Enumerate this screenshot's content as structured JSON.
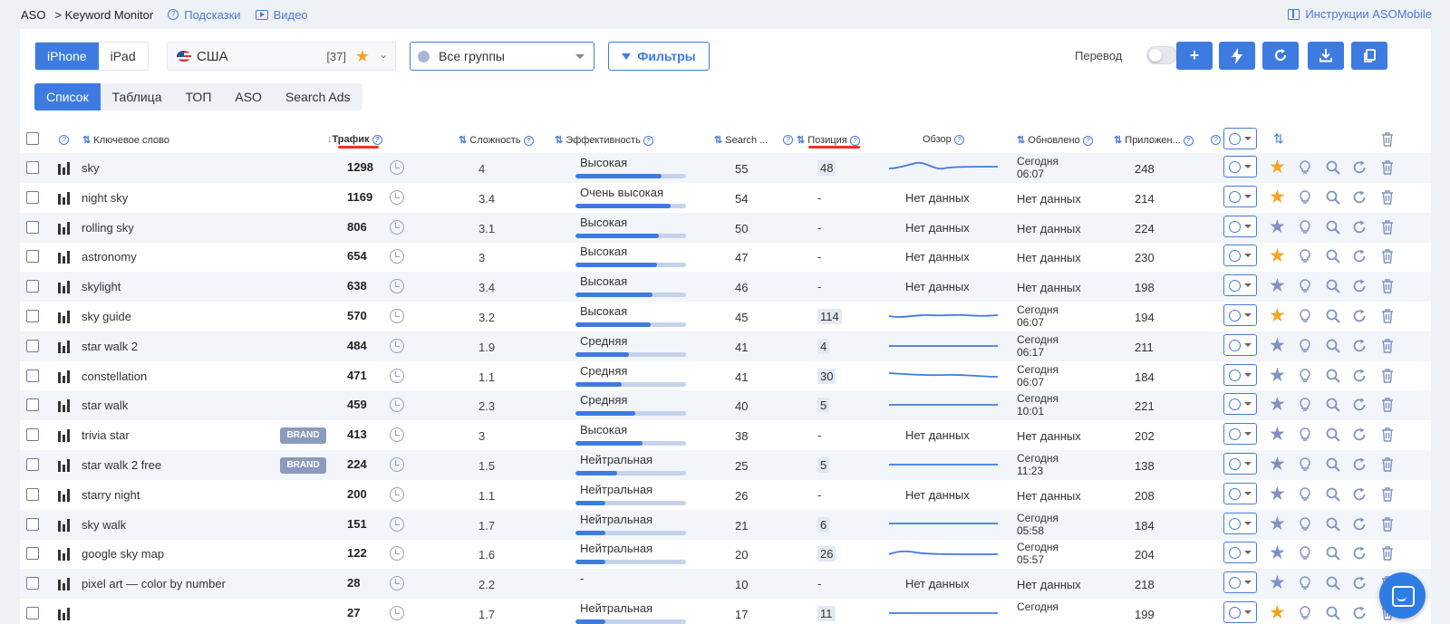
{
  "topbar": {
    "app": "ASO",
    "section": "> Keyword Monitor",
    "hints": "Подсказки",
    "video": "Видео",
    "instructions": "Инструкции ASOMobile"
  },
  "device_tabs": [
    "iPhone",
    "iPad"
  ],
  "device_selected": "iPhone",
  "country": {
    "name": "США",
    "count": "[37]"
  },
  "group_select": "Все группы",
  "filters_label": "Фильтры",
  "translate_label": "Перевод",
  "view_tabs": [
    "Список",
    "Таблица",
    "ТОП",
    "ASO",
    "Search Ads"
  ],
  "view_selected": "Список",
  "columns": {
    "keyword": "Ключевое слово",
    "traffic": "Трафик",
    "difficulty": "Сложность",
    "efficiency": "Эффективность",
    "search": "Search ...",
    "position": "Позиция",
    "overview": "Обзор",
    "updated": "Обновлено",
    "apps": "Приложен..."
  },
  "colors": {
    "accent": "#3d7be0",
    "star_active": "#f4a522",
    "star_inactive": "#7f92c2",
    "brand_badge": "#8b9bbd",
    "underline": "#e32"
  },
  "rows": [
    {
      "keyword": "sky",
      "brand": false,
      "traffic": "1298",
      "difficulty": "4",
      "efficiency": "Высокая",
      "eff_level": 0.78,
      "search": "55",
      "position": "48",
      "pos_box": true,
      "overview": "trend",
      "updated": [
        "Сегодня",
        "06:07"
      ],
      "apps": "248",
      "starred": true
    },
    {
      "keyword": "night sky",
      "brand": false,
      "traffic": "1169",
      "difficulty": "3.4",
      "efficiency": "Очень высокая",
      "eff_level": 0.86,
      "search": "54",
      "position": "-",
      "pos_box": false,
      "overview": "Нет данных",
      "updated": [
        "Нет данных"
      ],
      "apps": "214",
      "starred": true
    },
    {
      "keyword": "rolling sky",
      "brand": false,
      "traffic": "806",
      "difficulty": "3.1",
      "efficiency": "Высокая",
      "eff_level": 0.75,
      "search": "50",
      "position": "-",
      "pos_box": false,
      "overview": "Нет данных",
      "updated": [
        "Нет данных"
      ],
      "apps": "224",
      "starred": false
    },
    {
      "keyword": "astronomy",
      "brand": false,
      "traffic": "654",
      "difficulty": "3",
      "efficiency": "Высокая",
      "eff_level": 0.74,
      "search": "47",
      "position": "-",
      "pos_box": false,
      "overview": "Нет данных",
      "updated": [
        "Нет данных"
      ],
      "apps": "230",
      "starred": true
    },
    {
      "keyword": "skylight",
      "brand": false,
      "traffic": "638",
      "difficulty": "3.4",
      "efficiency": "Высокая",
      "eff_level": 0.7,
      "search": "46",
      "position": "-",
      "pos_box": false,
      "overview": "Нет данных",
      "updated": [
        "Нет данных"
      ],
      "apps": "198",
      "starred": false
    },
    {
      "keyword": "sky guide",
      "brand": false,
      "traffic": "570",
      "difficulty": "3.2",
      "efficiency": "Высокая",
      "eff_level": 0.68,
      "search": "45",
      "position": "114",
      "pos_box": true,
      "overview": "trend",
      "updated": [
        "Сегодня",
        "06:07"
      ],
      "apps": "194",
      "starred": true
    },
    {
      "keyword": "star walk 2",
      "brand": false,
      "traffic": "484",
      "difficulty": "1.9",
      "efficiency": "Средняя",
      "eff_level": 0.48,
      "search": "41",
      "position": "4",
      "pos_box": true,
      "overview": "trend",
      "updated": [
        "Сегодня",
        "06:17"
      ],
      "apps": "211",
      "starred": false
    },
    {
      "keyword": "constellation",
      "brand": false,
      "traffic": "471",
      "difficulty": "1.1",
      "efficiency": "Средняя",
      "eff_level": 0.42,
      "search": "41",
      "position": "30",
      "pos_box": true,
      "overview": "trend",
      "updated": [
        "Сегодня",
        "06:07"
      ],
      "apps": "184",
      "starred": false
    },
    {
      "keyword": "star walk",
      "brand": false,
      "traffic": "459",
      "difficulty": "2.3",
      "efficiency": "Средняя",
      "eff_level": 0.54,
      "search": "40",
      "position": "5",
      "pos_box": true,
      "overview": "trend",
      "updated": [
        "Сегодня",
        "10:01"
      ],
      "apps": "221",
      "starred": false
    },
    {
      "keyword": "trivia star",
      "brand": true,
      "traffic": "413",
      "difficulty": "3",
      "efficiency": "Высокая",
      "eff_level": 0.61,
      "search": "38",
      "position": "-",
      "pos_box": false,
      "overview": "Нет данных",
      "updated": [
        "Нет данных"
      ],
      "apps": "202",
      "starred": false
    },
    {
      "keyword": "star walk 2 free",
      "brand": true,
      "traffic": "224",
      "difficulty": "1.5",
      "efficiency": "Нейтральная",
      "eff_level": 0.38,
      "search": "25",
      "position": "5",
      "pos_box": true,
      "overview": "trend",
      "updated": [
        "Сегодня",
        "11:23"
      ],
      "apps": "138",
      "starred": false
    },
    {
      "keyword": "starry night",
      "brand": false,
      "traffic": "200",
      "difficulty": "1.1",
      "efficiency": "Нейтральная",
      "eff_level": 0.27,
      "search": "26",
      "position": "-",
      "pos_box": false,
      "overview": "Нет данных",
      "updated": [
        "Нет данных"
      ],
      "apps": "208",
      "starred": false
    },
    {
      "keyword": "sky walk",
      "brand": false,
      "traffic": "151",
      "difficulty": "1.7",
      "efficiency": "Нейтральная",
      "eff_level": 0.27,
      "search": "21",
      "position": "6",
      "pos_box": true,
      "overview": "trend",
      "updated": [
        "Сегодня",
        "05:58"
      ],
      "apps": "184",
      "starred": false
    },
    {
      "keyword": "google sky map",
      "brand": false,
      "traffic": "122",
      "difficulty": "1.6",
      "efficiency": "Нейтральная",
      "eff_level": 0.27,
      "search": "20",
      "position": "26",
      "pos_box": true,
      "overview": "trend",
      "updated": [
        "Сегодня",
        "05:57"
      ],
      "apps": "204",
      "starred": false
    },
    {
      "keyword": "pixel art — color by number",
      "brand": false,
      "traffic": "28",
      "difficulty": "2.2",
      "efficiency": "-",
      "eff_level": 0,
      "search": "10",
      "position": "-",
      "pos_box": false,
      "overview": "Нет данных",
      "updated": [
        "Нет данных"
      ],
      "apps": "218",
      "starred": false
    },
    {
      "keyword": "",
      "brand": false,
      "traffic": "27",
      "difficulty": "1.7",
      "efficiency": "Нейтральная",
      "eff_level": 0.27,
      "search": "17",
      "position": "11",
      "pos_box": true,
      "overview": "trend",
      "updated": [
        "Сегодня",
        ""
      ],
      "apps": "199",
      "starred": true
    }
  ]
}
